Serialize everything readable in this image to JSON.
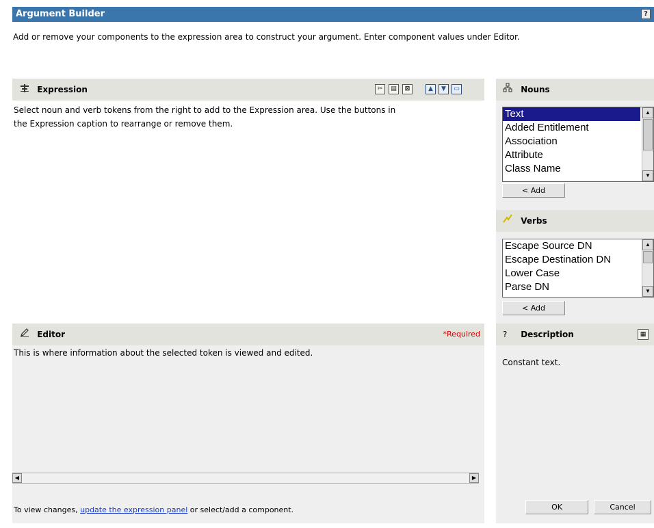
{
  "header": {
    "title": "Argument Builder",
    "help_icon": "?",
    "intro": "Add or remove your components to the expression area to construct your argument. Enter component values under Editor."
  },
  "expression": {
    "title": "Expression",
    "icon": "expression-icon",
    "text_line1": "Select noun and verb tokens from the right to add to the Expression area. Use the buttons in",
    "text_line2": "the Expression caption to rearrange or remove them.",
    "toolbar": [
      "cut-icon",
      "paste-icon",
      "delete-icon",
      "move-up-icon",
      "move-down-icon",
      "remove-icon"
    ]
  },
  "editor": {
    "title": "Editor",
    "required": "Required",
    "required_marker": "*",
    "text": "This is where information about the selected token is viewed and edited.",
    "footer_prefix": "To view changes, ",
    "footer_link": "update the expression panel",
    "footer_suffix": " or select/add a component."
  },
  "nouns": {
    "title": "Nouns",
    "items": [
      "Text",
      "Added Entitlement",
      "Association",
      "Attribute",
      "Class Name"
    ],
    "selected": "Text",
    "add_label": "< Add"
  },
  "verbs": {
    "title": "Verbs",
    "items": [
      "Escape Source DN",
      "Escape Destination DN",
      "Lower Case",
      "Parse DN"
    ],
    "add_label": "< Add"
  },
  "description": {
    "title": "Description",
    "text": "Constant text.",
    "ok_label": "OK",
    "cancel_label": "Cancel"
  },
  "colors": {
    "title_bar": "#3a76ab",
    "panel_header": "#e3e3dd",
    "selection": "#1a1a8c",
    "required": "#cc0000",
    "link": "#1a3cc6"
  }
}
